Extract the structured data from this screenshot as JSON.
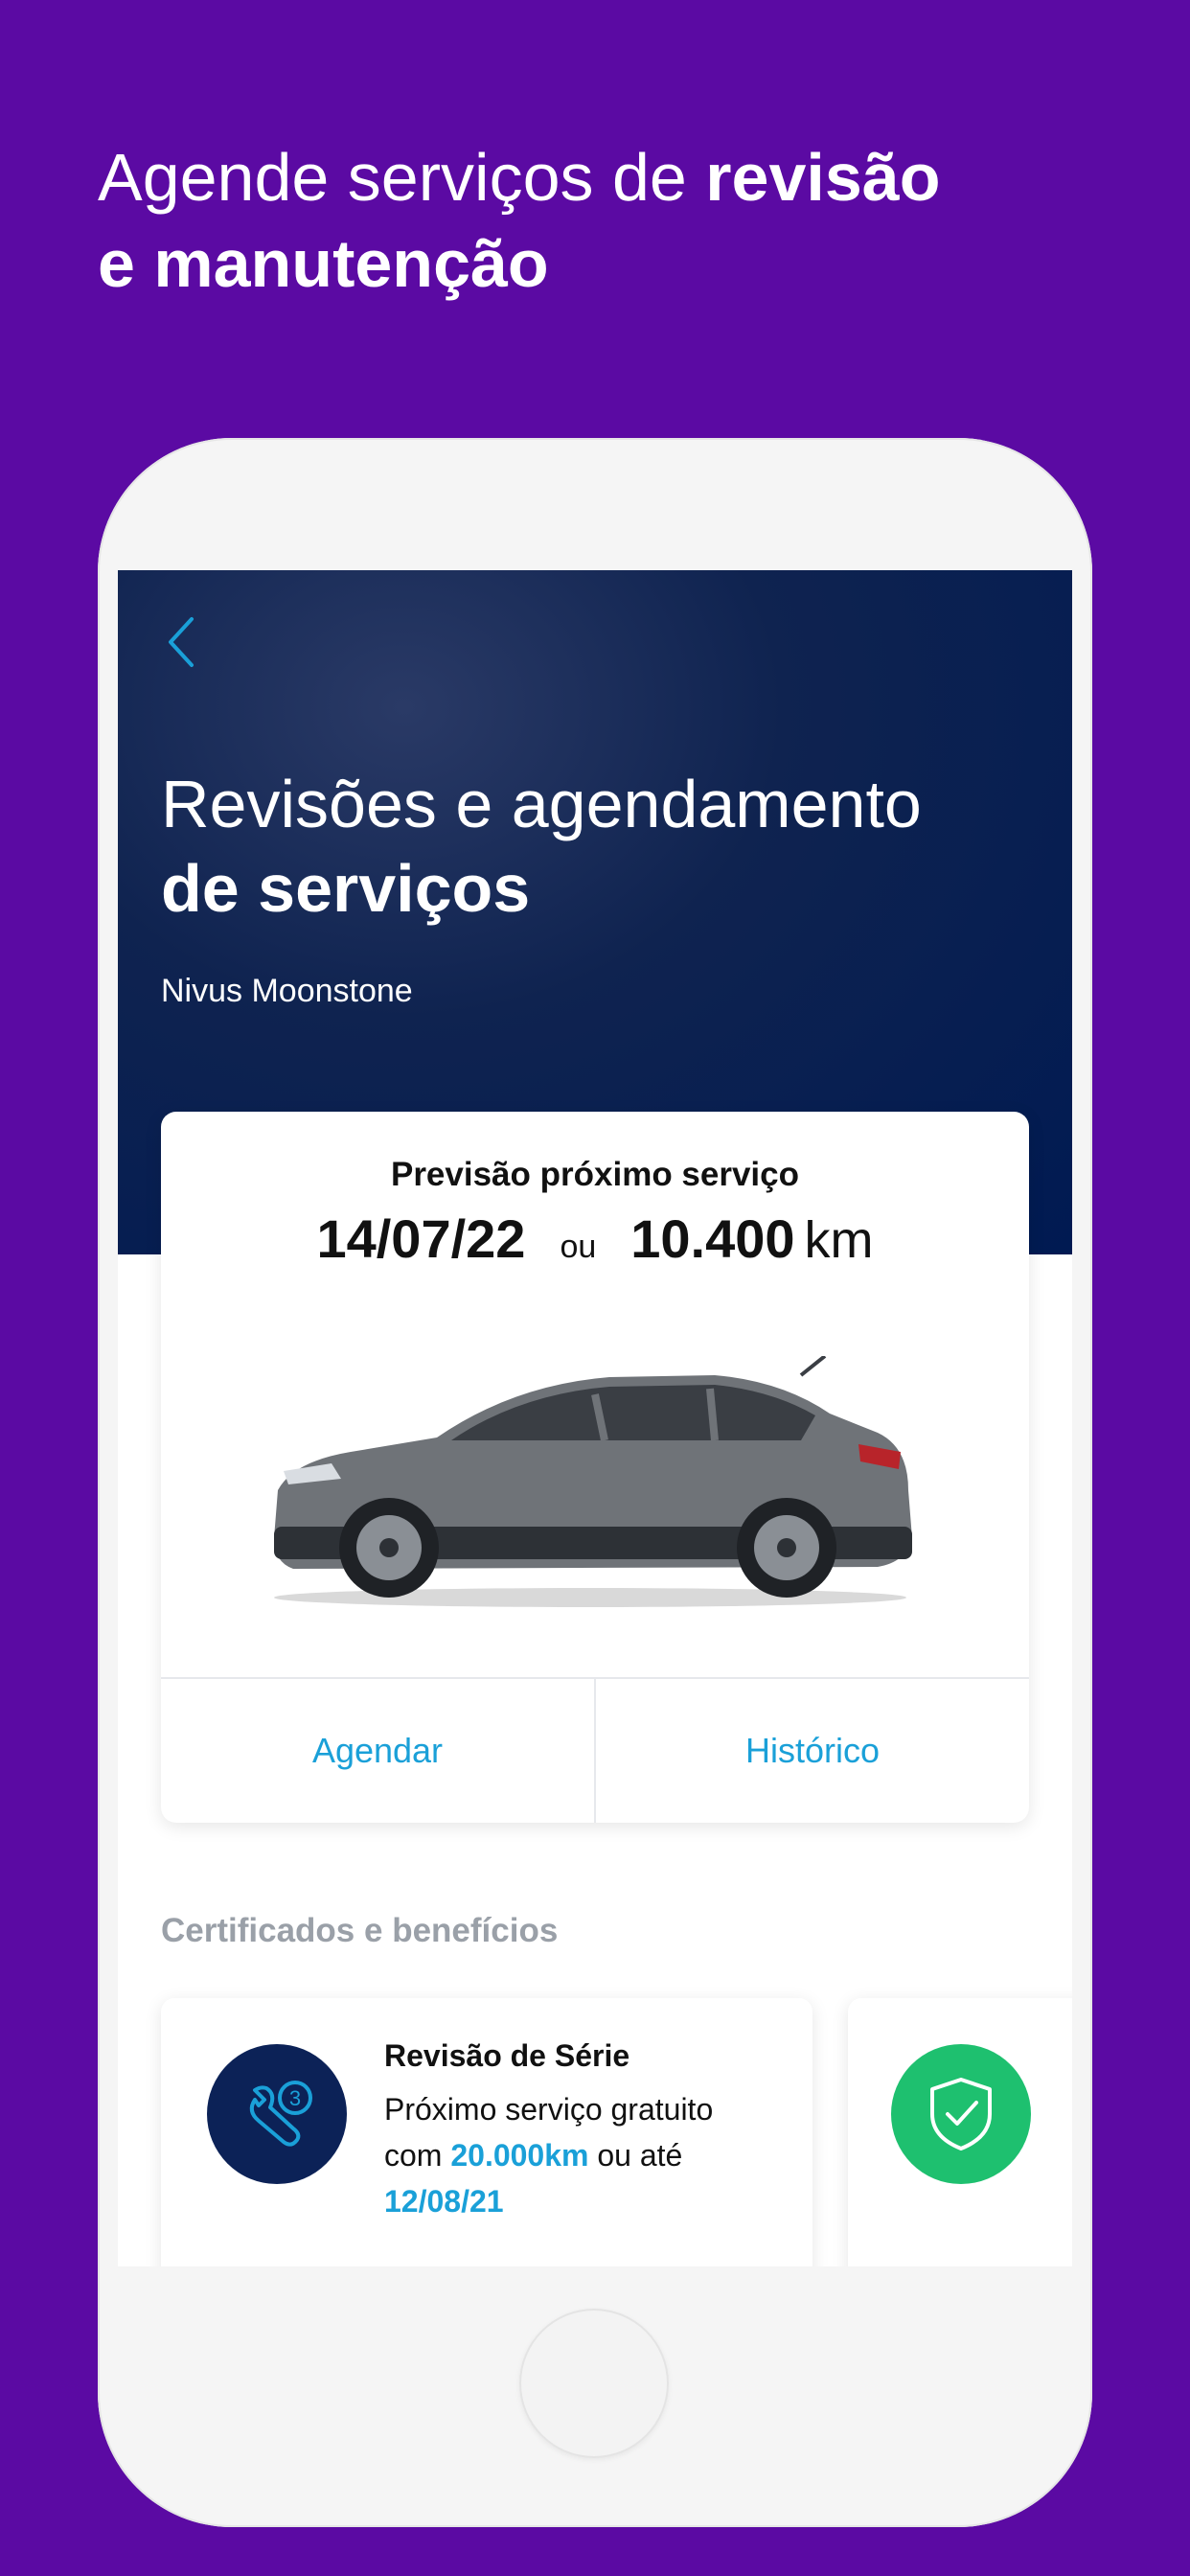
{
  "headline": {
    "light": "Agende serviços de ",
    "bold_1": "revisão",
    "bold_2": "e manutenção"
  },
  "screen": {
    "back_icon": "chevron-left-icon",
    "title_light": "Revisões e agendamento",
    "title_bold": "de serviços",
    "car_name": "Nivus Moonstone",
    "card": {
      "label": "Previsão próximo serviço",
      "date": "14/07/22",
      "or": "ou",
      "km": "10.400",
      "km_unit": "km",
      "actions": {
        "schedule": "Agendar",
        "history": "Histórico"
      }
    },
    "section_label": "Certificados e benefícios",
    "benefits": [
      {
        "icon": "wrench-service-icon",
        "icon_number": "3",
        "title": "Revisão de Série",
        "text_1": "Próximo serviço gratuito",
        "text_2": "com ",
        "highlight_km": "20.000km",
        "text_3": " ou até",
        "highlight_date": "12/08/21"
      },
      {
        "icon": "shield-check-icon"
      }
    ]
  },
  "colors": {
    "background": "#5b0aa3",
    "hero": "#001a52",
    "accent": "#1aa0d8",
    "green": "#1ec06f"
  }
}
